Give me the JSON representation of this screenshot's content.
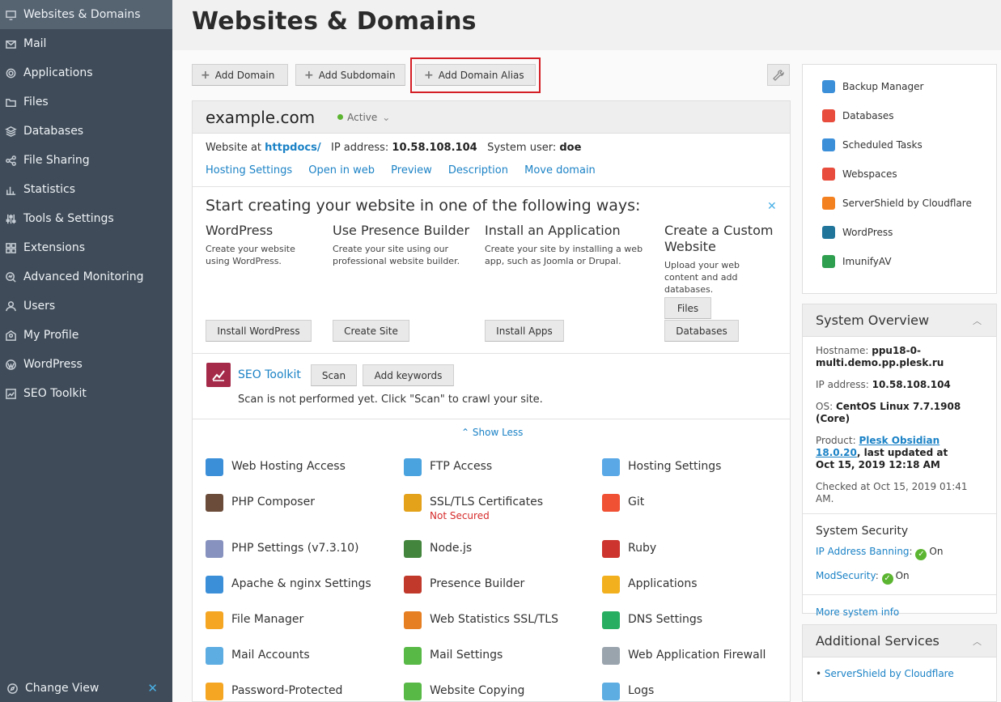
{
  "sidebar": {
    "items": [
      {
        "label": "Websites & Domains",
        "icon": "monitor-icon"
      },
      {
        "label": "Mail",
        "icon": "mail-icon"
      },
      {
        "label": "Applications",
        "icon": "gear-icon"
      },
      {
        "label": "Files",
        "icon": "folder-icon"
      },
      {
        "label": "Databases",
        "icon": "layers-icon"
      },
      {
        "label": "File Sharing",
        "icon": "share-icon"
      },
      {
        "label": "Statistics",
        "icon": "bar-chart-icon"
      },
      {
        "label": "Tools & Settings",
        "icon": "sliders-icon"
      },
      {
        "label": "Extensions",
        "icon": "blocks-icon"
      },
      {
        "label": "Advanced Monitoring",
        "icon": "monitoring-icon"
      },
      {
        "label": "Users",
        "icon": "user-icon"
      },
      {
        "label": "My Profile",
        "icon": "profile-icon"
      },
      {
        "label": "WordPress",
        "icon": "wordpress-icon"
      },
      {
        "label": "SEO Toolkit",
        "icon": "seo-icon"
      }
    ],
    "footer": "Change View"
  },
  "page": {
    "title": "Websites & Domains"
  },
  "toolbar": {
    "add_domain": "Add Domain",
    "add_subdomain": "Add Subdomain",
    "add_domain_alias": "Add Domain Alias"
  },
  "domain": {
    "name": "example.com",
    "status": "Active",
    "website_at_label": "Website at",
    "website_at_value": "httpdocs/",
    "ip_label": "IP address:",
    "ip_value": "10.58.108.104",
    "user_label": "System user:",
    "user_value": "doe",
    "links": [
      "Hosting Settings",
      "Open in web",
      "Preview",
      "Description",
      "Move domain"
    ]
  },
  "start": {
    "title": "Start creating your website in one of the following ways:",
    "options": [
      {
        "title": "WordPress",
        "desc": "Create your website using WordPress.",
        "button": "Install WordPress"
      },
      {
        "title": "Use Presence Builder",
        "desc": "Create your site using our professional website builder.",
        "button": "Create Site"
      },
      {
        "title": "Install an Application",
        "desc": "Create your site by installing a web app, such as Joomla or Drupal.",
        "button": "Install Apps"
      },
      {
        "title": "Create a Custom Website",
        "desc": "Upload your web content and add databases.",
        "button": "Files",
        "button2": "Databases"
      }
    ]
  },
  "seo": {
    "title": "SEO Toolkit",
    "scan": "Scan",
    "add_keywords": "Add keywords",
    "message": "Scan is not performed yet. Click \"Scan\" to crawl your site."
  },
  "show_less": "Show Less",
  "tools": [
    {
      "label": "Web Hosting Access",
      "color": "#3b8fd9"
    },
    {
      "label": "FTP Access",
      "color": "#4aa3df"
    },
    {
      "label": "Hosting Settings",
      "color": "#5aa9e6"
    },
    {
      "label": "PHP Composer",
      "color": "#6b4b3a"
    },
    {
      "label": "SSL/TLS Certificates",
      "sub": "Not Secured",
      "color": "#e3a21a"
    },
    {
      "label": "Git",
      "color": "#f05033"
    },
    {
      "label": "PHP Settings (v7.3.10)",
      "color": "#8892bf"
    },
    {
      "label": "Node.js",
      "color": "#43853d"
    },
    {
      "label": "Ruby",
      "color": "#cc342d"
    },
    {
      "label": "Apache & nginx Settings",
      "color": "#3b8fd9"
    },
    {
      "label": "Presence Builder",
      "color": "#c0392b"
    },
    {
      "label": "Applications",
      "color": "#f2b01e"
    },
    {
      "label": "File Manager",
      "color": "#f5a623"
    },
    {
      "label": "Web Statistics SSL/TLS",
      "color": "#e67e22"
    },
    {
      "label": "DNS Settings",
      "color": "#27ae60"
    },
    {
      "label": "Mail Accounts",
      "color": "#5dade2"
    },
    {
      "label": "Mail Settings",
      "color": "#58b947"
    },
    {
      "label": "Web Application Firewall",
      "color": "#9aa4ad"
    },
    {
      "label": "Password-Protected",
      "color": "#f5a623"
    },
    {
      "label": "Website Copying",
      "color": "#58b947"
    },
    {
      "label": "Logs",
      "color": "#5dade2"
    }
  ],
  "quick_links": [
    {
      "label": "Backup Manager",
      "color": "#3b8fd9"
    },
    {
      "label": "Databases",
      "color": "#e74c3c"
    },
    {
      "label": "Scheduled Tasks",
      "color": "#3b8fd9"
    },
    {
      "label": "Webspaces",
      "color": "#e74c3c"
    },
    {
      "label": "ServerShield by Cloudflare",
      "color": "#f48120"
    },
    {
      "label": "WordPress",
      "color": "#21759b"
    },
    {
      "label": "ImunifyAV",
      "color": "#2e9e4f"
    }
  ],
  "system_overview": {
    "title": "System Overview",
    "hostname_label": "Hostname:",
    "hostname_value": "ppu18-0-multi.demo.pp.plesk.ru",
    "ip_label": "IP address:",
    "ip_value": "10.58.108.104",
    "os_label": "OS:",
    "os_value": "CentOS Linux 7.7.1908 (Core)",
    "product_label": "Product:",
    "product_value": "Plesk Obsidian 18.0.20",
    "updated_label": ", last updated at",
    "updated_value": "Oct 15, 2019 12:18 AM",
    "checked": "Checked at Oct 15, 2019 01:41 AM.",
    "security_title": "System Security",
    "ip_banning": "IP Address Banning",
    "ip_banning_state": "On",
    "modsecurity": "ModSecurity",
    "modsecurity_state": "On",
    "more_info": "More system info"
  },
  "additional_services": {
    "title": "Additional Services",
    "items": [
      "ServerShield by Cloudflare"
    ]
  }
}
